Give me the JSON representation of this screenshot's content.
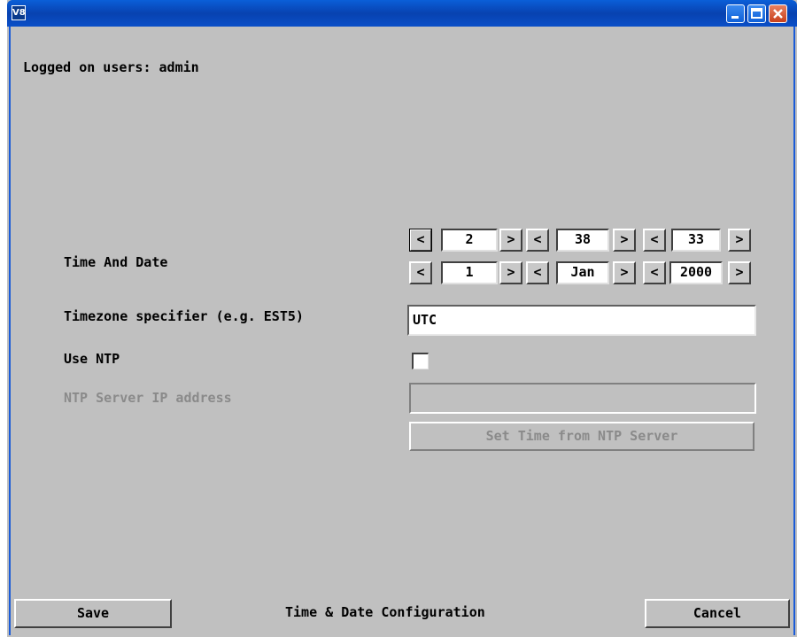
{
  "window": {
    "icon_text": "V8",
    "title": ""
  },
  "header": {
    "logged_on": "Logged on users: admin"
  },
  "time_date": {
    "label": "Time And Date",
    "decrement_label": "<",
    "increment_label": ">",
    "hour": "2",
    "minute": "38",
    "second": "33",
    "day": "1",
    "month": "Jan",
    "year": "2000"
  },
  "timezone": {
    "label": "Timezone specifier (e.g. EST5)",
    "value": "UTC"
  },
  "ntp": {
    "use_label": "Use NTP",
    "checked": false,
    "server_label": "NTP Server IP address",
    "server_value": "",
    "set_time_button": "Set Time from NTP Server"
  },
  "footer": {
    "save_button": "Save",
    "page_title": "Time & Date Configuration",
    "cancel_button": "Cancel"
  },
  "colors": {
    "titlebar": "#0842b0",
    "background": "#c0c0c0",
    "disabled_text": "#8a8a8a"
  }
}
